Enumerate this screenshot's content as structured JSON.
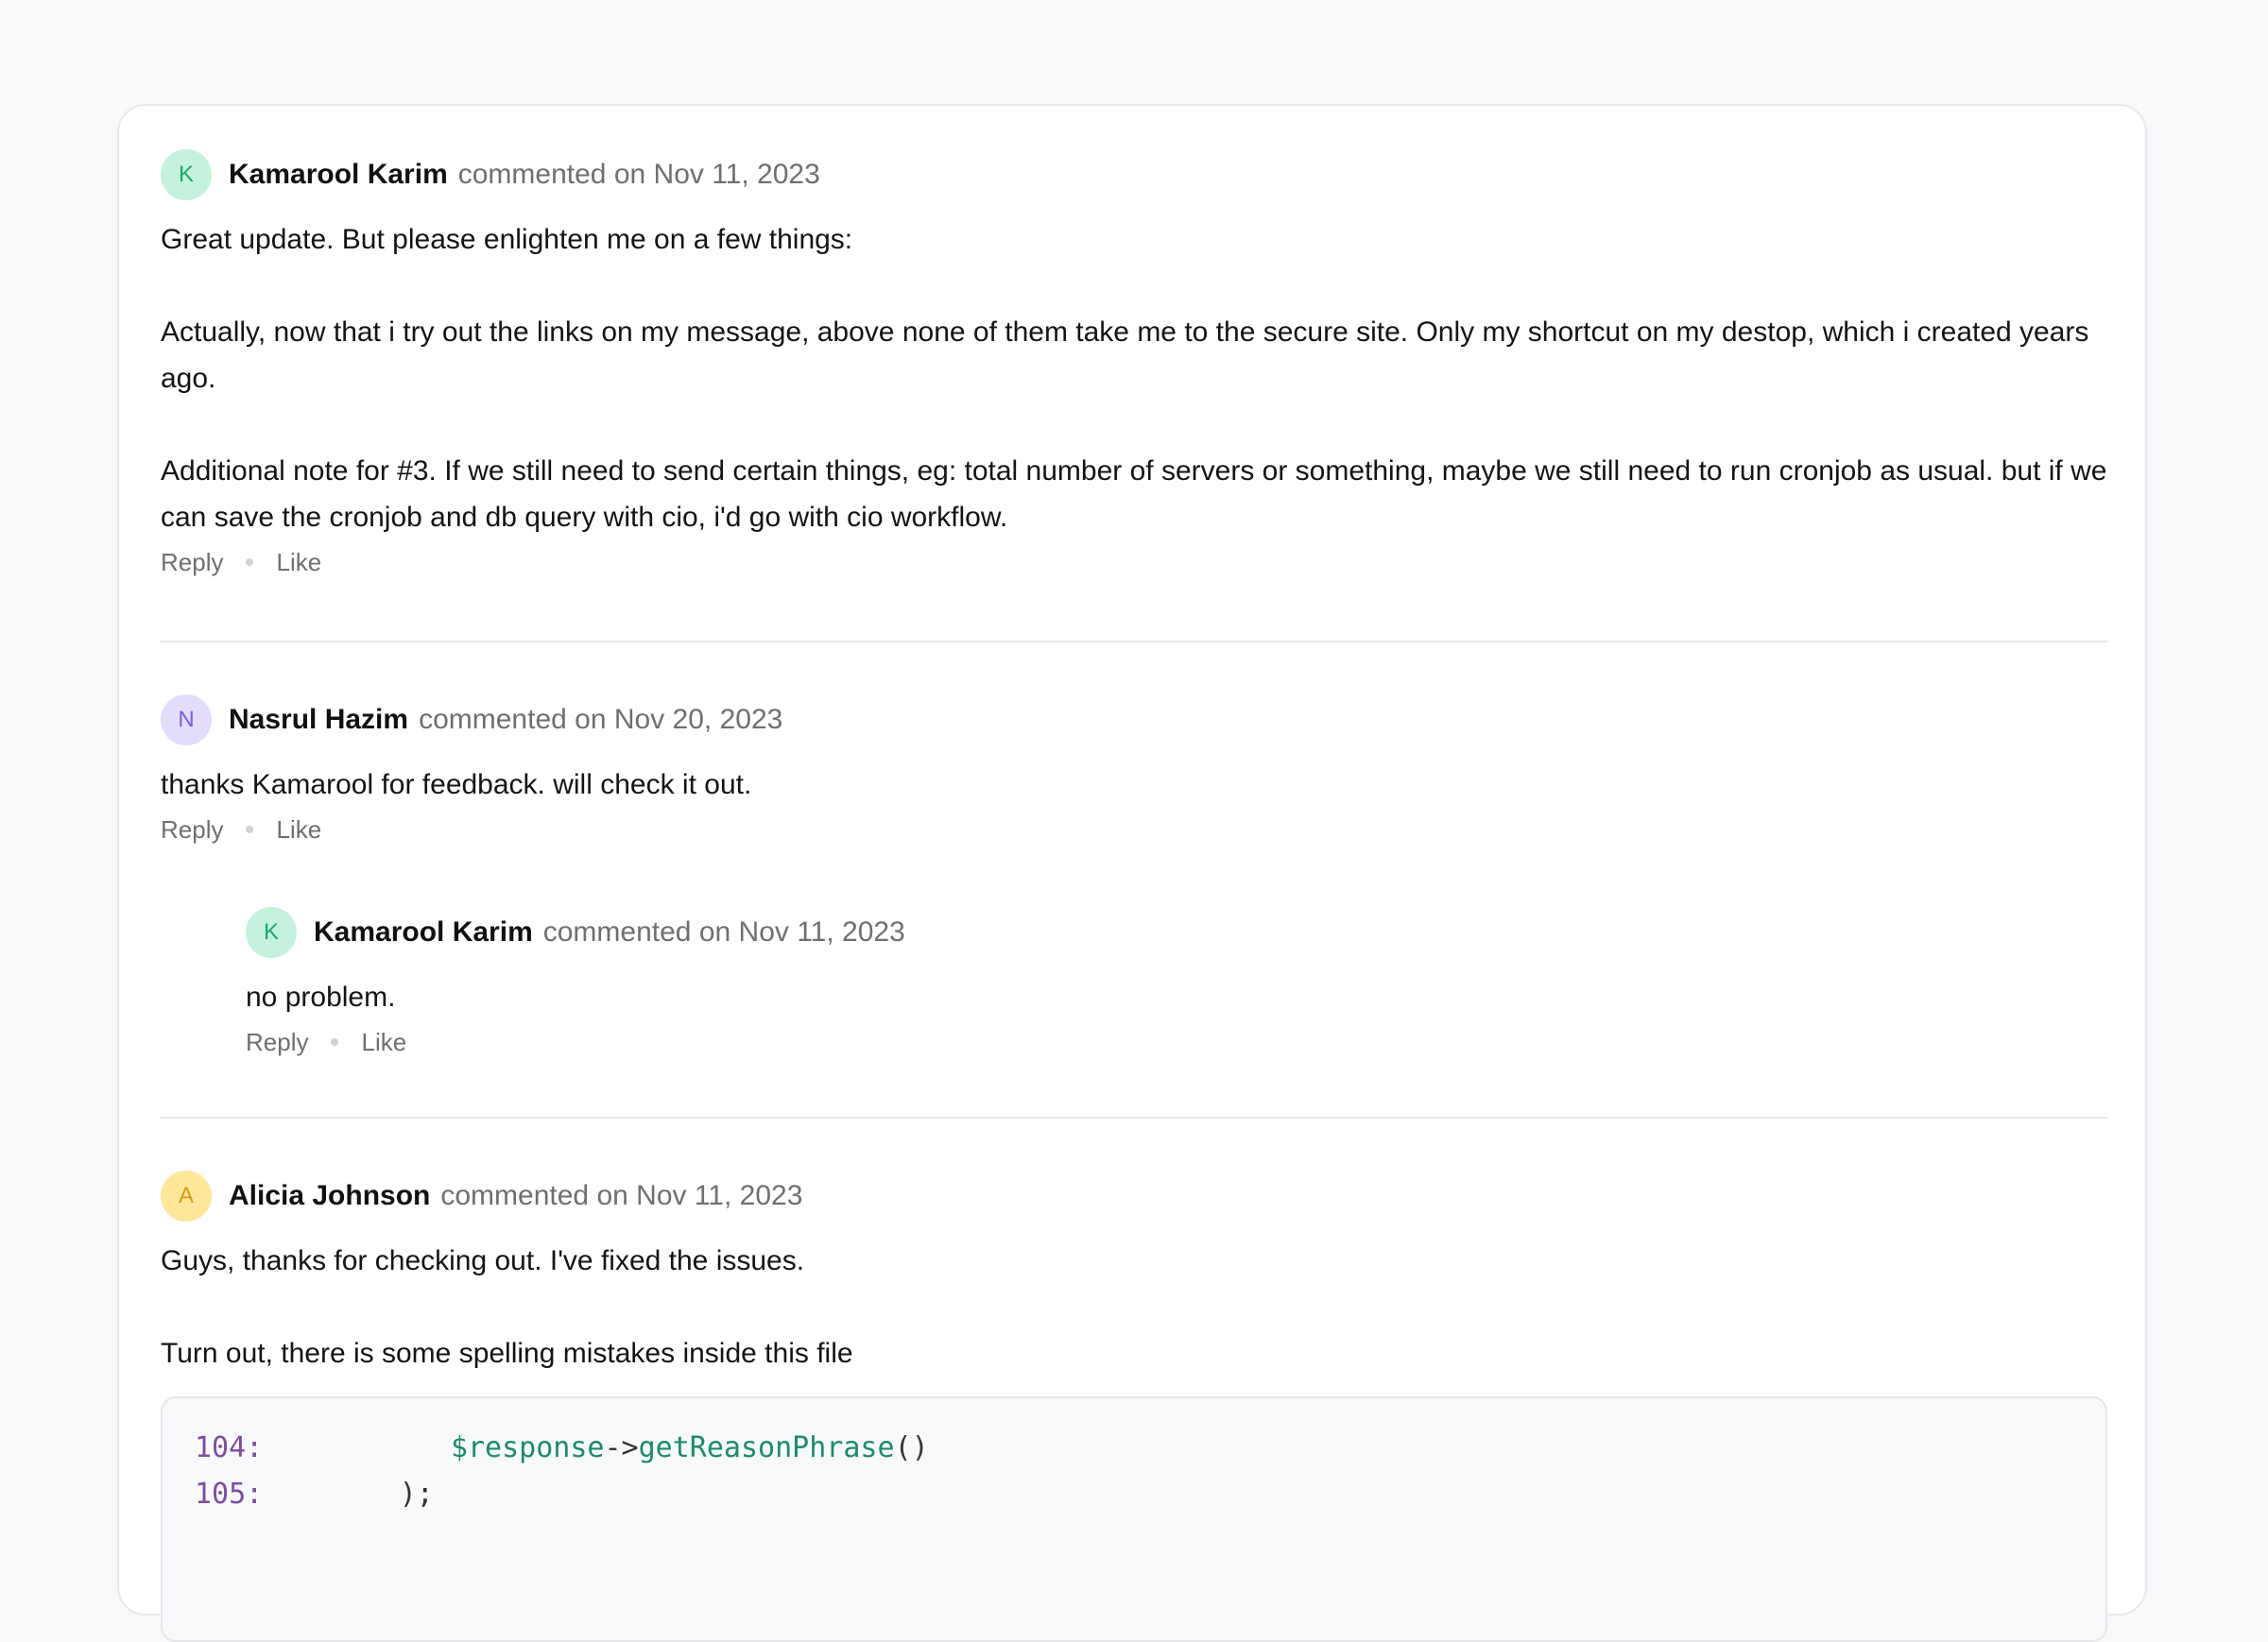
{
  "comments": [
    {
      "avatar_letter": "K",
      "author": "Kamarool Karim",
      "meta": "commented on Nov 11, 2023",
      "paragraphs": [
        "Great update. But please enlighten me on a few things:",
        "Actually, now that i try out the links on my message, above none of them take me to the secure site. Only my shortcut on my destop, which i created years ago.",
        "Additional note for #3. If we still need to send certain things, eg: total number of servers or something, maybe we still need to run cronjob as usual. but if we can save the cronjob and db query with cio, i'd go with cio workflow."
      ],
      "reply_label": "Reply",
      "like_label": "Like"
    },
    {
      "avatar_letter": "N",
      "author": "Nasrul Hazim",
      "meta": "commented on Nov 20, 2023",
      "paragraphs": [
        "thanks Kamarool for feedback. will check it out."
      ],
      "reply_label": "Reply",
      "like_label": "Like",
      "replies": [
        {
          "avatar_letter": "K",
          "author": "Kamarool Karim",
          "meta": "commented on Nov 11, 2023",
          "paragraphs": [
            "no problem."
          ],
          "reply_label": "Reply",
          "like_label": "Like"
        }
      ]
    },
    {
      "avatar_letter": "A",
      "author": "Alicia Johnson",
      "meta": "commented on Nov 11, 2023",
      "paragraphs": [
        "Guys, thanks for checking out. I've fixed the issues.",
        "Turn out, there is some spelling mistakes inside this file"
      ],
      "code": [
        {
          "line_no": "104:",
          "indent": "           ",
          "var": "$response",
          "arrow": "->",
          "method": "getReasonPhrase",
          "rest": "()"
        },
        {
          "line_no": "105:",
          "indent": "        ",
          "var": "",
          "arrow": "",
          "method": "",
          "rest": ");"
        }
      ]
    }
  ],
  "colors": {
    "avatar_green": "#c4f2dc",
    "avatar_purple": "#e4dcfb",
    "avatar_yellow": "#fde79a"
  }
}
